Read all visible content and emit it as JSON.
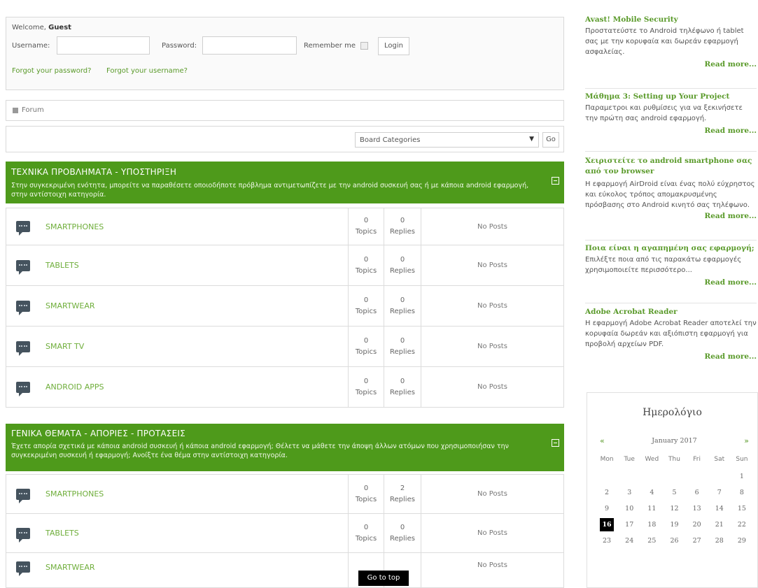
{
  "login": {
    "welcome_prefix": "Welcome,",
    "welcome_user": "Guest",
    "username_label": "Username:",
    "password_label": "Password:",
    "remember_label": "Remember me",
    "login_button": "Login",
    "forgot_password": "Forgot your password?",
    "forgot_username": "Forgot your username?"
  },
  "breadcrumb": {
    "label": "Forum"
  },
  "board_select": {
    "selected": "Board Categories",
    "go_label": "Go"
  },
  "categories": [
    {
      "title": "ΤΕΧΝΙΚΑ ΠΡΟΒΛΗΜΑΤΑ - ΥΠΟΣΤΗΡΙΞΗ",
      "description": "Στην συγκεκριμένη ενότητα, μπορείτε να παραθέσετε οποιοδήποτε πρόβλημα αντιμετωπίζετε με την android συσκευή σας ή με κάποια android εφαρμογή, στην αντίστοιχη κατηγορία.",
      "forums": [
        {
          "name": "SMARTPHONES",
          "topics": "0",
          "topics_label": "Topics",
          "replies": "0",
          "replies_label": "Replies",
          "last": "No Posts"
        },
        {
          "name": "TABLETS",
          "topics": "0",
          "topics_label": "Topics",
          "replies": "0",
          "replies_label": "Replies",
          "last": "No Posts"
        },
        {
          "name": "SMARTWEAR",
          "topics": "0",
          "topics_label": "Topics",
          "replies": "0",
          "replies_label": "Replies",
          "last": "No Posts"
        },
        {
          "name": "SMART TV",
          "topics": "0",
          "topics_label": "Topics",
          "replies": "0",
          "replies_label": "Replies",
          "last": "No Posts"
        },
        {
          "name": "ANDROID APPS",
          "topics": "0",
          "topics_label": "Topics",
          "replies": "0",
          "replies_label": "Replies",
          "last": "No Posts"
        }
      ]
    },
    {
      "title": "ΓΕΝΙΚΑ ΘΕΜΑΤΑ - ΑΠΟΡΙΕΣ - ΠΡΟΤΑΣΕΙΣ",
      "description": "Έχετε απορία σχετικά με κάποια android συσκευή ή κάποια android εφαρμογή; Θέλετε να μάθετε την άποψη άλλων ατόμων που χρησιμοποιήσαν την συγκεκριμένη συσκευή ή εφαρμογή; Ανοίξτε ένα θέμα στην αντίστοιχη κατηγορία.",
      "forums": [
        {
          "name": "SMARTPHONES",
          "topics": "0",
          "topics_label": "Topics",
          "replies": "2",
          "replies_label": "Replies",
          "last": "No Posts"
        },
        {
          "name": "TABLETS",
          "topics": "0",
          "topics_label": "Topics",
          "replies": "0",
          "replies_label": "Replies",
          "last": "No Posts"
        },
        {
          "name": "SMARTWEAR",
          "topics": "",
          "topics_label": "",
          "replies": "",
          "replies_label": "",
          "last": "No Posts"
        }
      ]
    }
  ],
  "go_to_top": "Go to top",
  "sidebar": {
    "articles": [
      {
        "title": "Avast! Mobile Security",
        "text": "Προστατεύστε το Android τηλέφωνο ή tablet σας με την κορυφαία και δωρεάν εφαρμογή ασφαλείας.",
        "more": "Read more..."
      },
      {
        "title": "Μάθημα 3: Setting up Your Project",
        "text": "Παραμετροι και ρυθμίσεις για να ξεκινήσετε την πρώτη σας android εφαρμογή.",
        "more": "Read more..."
      },
      {
        "title": "Χειριστείτε το android smartphone σας από τον browser",
        "text": "Η εφαρμογή AirDroid είναι ένας πολύ εύχρηστος και εύκολος τρόπος απομακρυσμένης πρόσβασης στο Android κινητό σας τηλέφωνο.",
        "more": "Read more..."
      },
      {
        "title": "Ποια είναι η αγαπημένη σας εφαρμογή;",
        "text": "Επιλέξτε ποια από τις παρακάτω εφαρμογές χρησιμοποιείτε περισσότερο...",
        "more": "Read more..."
      },
      {
        "title": "Adobe Acrobat Reader",
        "text": "Η εφαρμογή Adobe Acrobat Reader αποτελεί την κορυφαία δωρεάν και αξιόπιστη εφαρμογή για προβολή αρχείων PDF.",
        "more": "Read more..."
      }
    ],
    "calendar": {
      "title": "Ημερολόγιο",
      "prev": "«",
      "next": "»",
      "month": "January 2017",
      "weekdays": [
        "Mon",
        "Tue",
        "Wed",
        "Thu",
        "Fri",
        "Sat",
        "Sun"
      ],
      "weeks": [
        [
          "",
          "",
          "",
          "",
          "",
          "",
          "1"
        ],
        [
          "2",
          "3",
          "4",
          "5",
          "6",
          "7",
          "8"
        ],
        [
          "9",
          "10",
          "11",
          "12",
          "13",
          "14",
          "15"
        ],
        [
          "16",
          "17",
          "18",
          "19",
          "20",
          "21",
          "22"
        ],
        [
          "23",
          "24",
          "25",
          "26",
          "27",
          "28",
          "29"
        ]
      ],
      "today": "16"
    }
  }
}
